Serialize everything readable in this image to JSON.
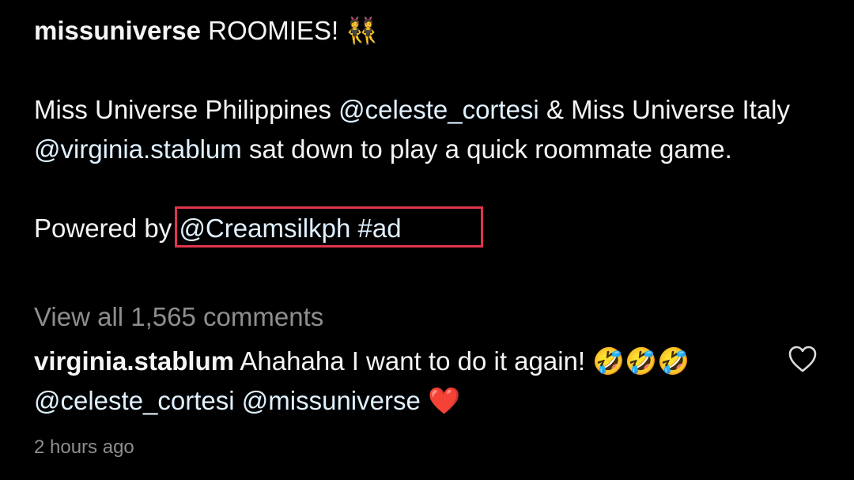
{
  "caption": {
    "username": "missuniverse",
    "headline": "ROOMIES!",
    "headline_emoji": "👯",
    "body_parts": {
      "p1": "Miss Universe Philippines",
      "mention1": "@celeste_cortesi",
      "p2": "& Miss Universe Italy",
      "mention2": "@virginia.stablum",
      "p3": "sat down to play a quick roommate game."
    },
    "powered_by": "Powered by",
    "sponsor_mention": "@Creamsilkph",
    "hashtag": "#ad"
  },
  "view_comments": "View all 1,565 comments",
  "comment": {
    "username": "virginia.stablum",
    "text": "Ahahaha I want to do it again!",
    "emojis": "🤣🤣🤣",
    "mention1": "@celeste_cortesi",
    "mention2": "@missuniverse",
    "heart_emoji": "❤️"
  },
  "timestamp": "2 hours ago",
  "colors": {
    "background": "#000000",
    "text": "#f5f5f5",
    "muted": "#8e8e8e",
    "mention": "#e0f1ff",
    "highlight_box": "#e0344c"
  },
  "icons": {
    "like": "heart-outline-icon"
  }
}
